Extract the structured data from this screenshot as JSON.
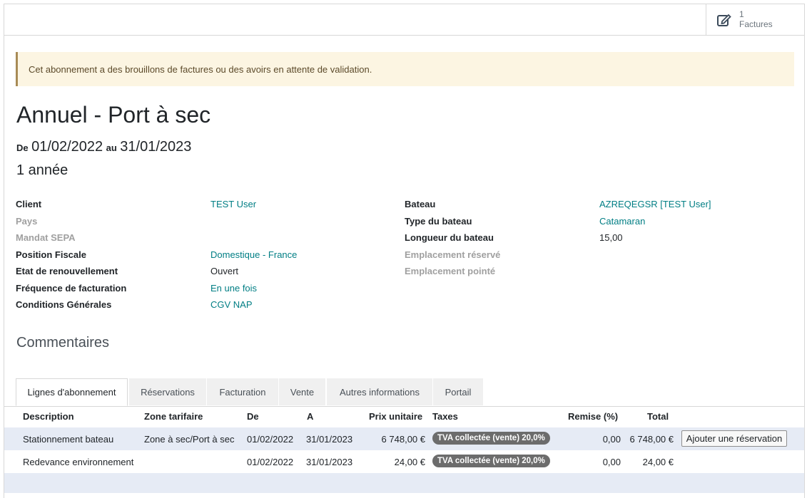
{
  "stat_button": {
    "value": "1",
    "label": "Factures",
    "icon": "pencil-square-icon"
  },
  "alert": {
    "text": "Cet abonnement a des brouillons de factures ou des avoirs en attente de validation."
  },
  "header": {
    "title": "Annuel - Port à sec",
    "from_label": "De",
    "from_date": "01/02/2022",
    "to_label": "au",
    "to_date": "31/01/2023",
    "duration": "1 année"
  },
  "left_fields": [
    {
      "label": "Client",
      "value": "TEST User"
    },
    {
      "label": "Pays",
      "value": ""
    },
    {
      "label": "Mandat SEPA",
      "value": ""
    },
    {
      "label": "Position Fiscale",
      "value": "Domestique - France"
    },
    {
      "label": "Etat de renouvellement",
      "value": "Ouvert"
    },
    {
      "label": "Fréquence de facturation",
      "value": "En une fois"
    },
    {
      "label": "Conditions Générales",
      "value": "CGV NAP"
    }
  ],
  "right_fields": [
    {
      "label": "Bateau",
      "value": "AZREQEGSR [TEST User]"
    },
    {
      "label": "Type du bateau",
      "value": "Catamaran"
    },
    {
      "label": "Longueur du bateau",
      "value": "15,00"
    },
    {
      "label": "Emplacement réservé",
      "value": ""
    },
    {
      "label": "Emplacement pointé",
      "value": ""
    }
  ],
  "comments_title": "Commentaires",
  "tabs": [
    {
      "label": "Lignes d'abonnement",
      "active": true
    },
    {
      "label": "Réservations"
    },
    {
      "label": "Facturation"
    },
    {
      "label": "Vente"
    },
    {
      "label": "Autres informations"
    },
    {
      "label": "Portail"
    }
  ],
  "table": {
    "columns": [
      "Description",
      "Zone tarifaire",
      "De",
      "A",
      "Prix unitaire",
      "Taxes",
      "Remise (%)",
      "Total"
    ],
    "rows": [
      {
        "description": "Stationnement bateau",
        "zone": "Zone à sec/Port à sec",
        "de": "01/02/2022",
        "a": "31/01/2023",
        "prix": "6 748,00 €",
        "taxe": "TVA collectée (vente) 20,0%",
        "remise": "0,00",
        "total": "6 748,00 €",
        "action": "Ajouter une réservation"
      },
      {
        "description": "Redevance environnement",
        "zone": "",
        "de": "01/02/2022",
        "a": "31/01/2023",
        "prix": "24,00 €",
        "taxe": "TVA collectée (vente) 20,0%",
        "remise": "0,00",
        "total": "24,00 €"
      }
    ]
  },
  "colors": {
    "link": "#017e84",
    "alert_bg": "#fcf5e2",
    "row_highlight": "#e6ebf5",
    "badge": "#6c6c6c"
  }
}
